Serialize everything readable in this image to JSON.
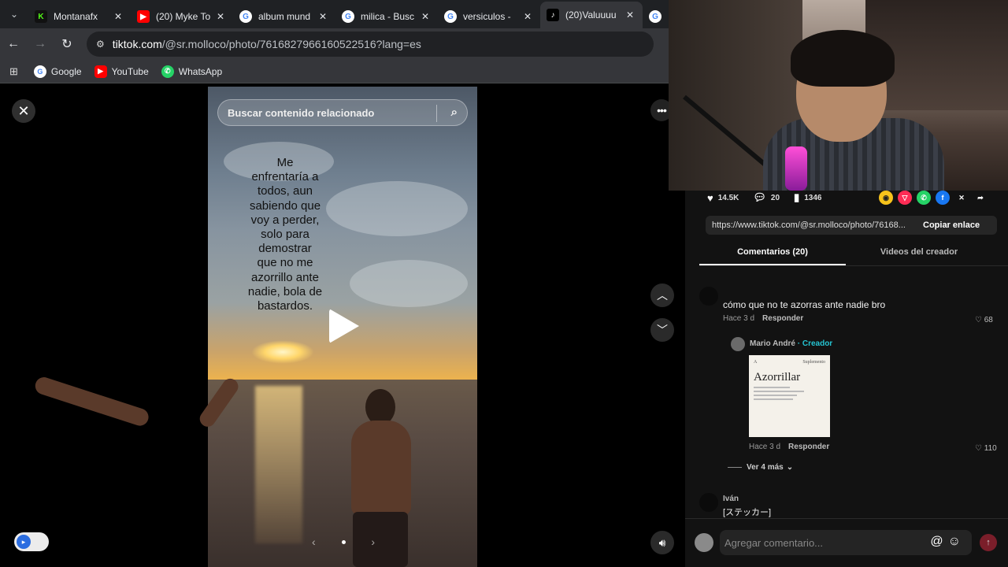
{
  "browser": {
    "tabs": [
      {
        "title": "Montanafx",
        "favicon": "K",
        "color": "#53fc18"
      },
      {
        "title": "(20) Myke To",
        "favicon": "▶",
        "color": "#ff0000"
      },
      {
        "title": "album mund",
        "favicon": "G",
        "color": "#ffffff"
      },
      {
        "title": "milica - Busc",
        "favicon": "G",
        "color": "#ffffff"
      },
      {
        "title": "versiculos -",
        "favicon": "G",
        "color": "#ffffff"
      },
      {
        "title": "(20)Valuuuu",
        "favicon": "♪",
        "color": "#000000",
        "active": true
      },
      {
        "title": "s",
        "favicon": "G",
        "color": "#ffffff"
      }
    ],
    "url_host": "tiktok.com",
    "url_path": "/@sr.molloco/photo/7616827966160522516?lang=es",
    "bookmarks": [
      {
        "label": "Google",
        "icon": "google-icon"
      },
      {
        "label": "YouTube",
        "icon": "youtube-icon"
      },
      {
        "label": "WhatsApp",
        "icon": "whatsapp-icon"
      }
    ]
  },
  "viewer": {
    "search_placeholder": "Buscar contenido relacionado",
    "overlay_text": "Me enfrentaría a todos, aun sabiendo que voy a perder, solo para demostrar que no me azorrillo ante nadie, bola de bastardos."
  },
  "panel": {
    "likes": "14.5K",
    "comments": "20",
    "saves": "1346",
    "share_link": "https://www.tiktok.com/@sr.molloco/photo/76168...",
    "copy_label": "Copiar enlace",
    "tab_comments": "Comentarios (20)",
    "tab_videos": "Videos del creador",
    "comments_list": [
      {
        "text": "cómo que no te azorras ante nadie bro",
        "time": "Hace 3 d",
        "reply": "Responder",
        "likes": "68"
      }
    ],
    "reply": {
      "user": "Mario André",
      "tag": "· Creador",
      "time": "Hace 3 d",
      "reply_label": "Responder",
      "likes": "110",
      "image_title": "Azorrillar",
      "image_letter": "A",
      "image_label": "Suplemento"
    },
    "more_replies": "Ver 4 más",
    "comment2": {
      "user": "Iván",
      "text": "[ステッカー]"
    },
    "add_comment_placeholder": "Agregar comentario..."
  }
}
